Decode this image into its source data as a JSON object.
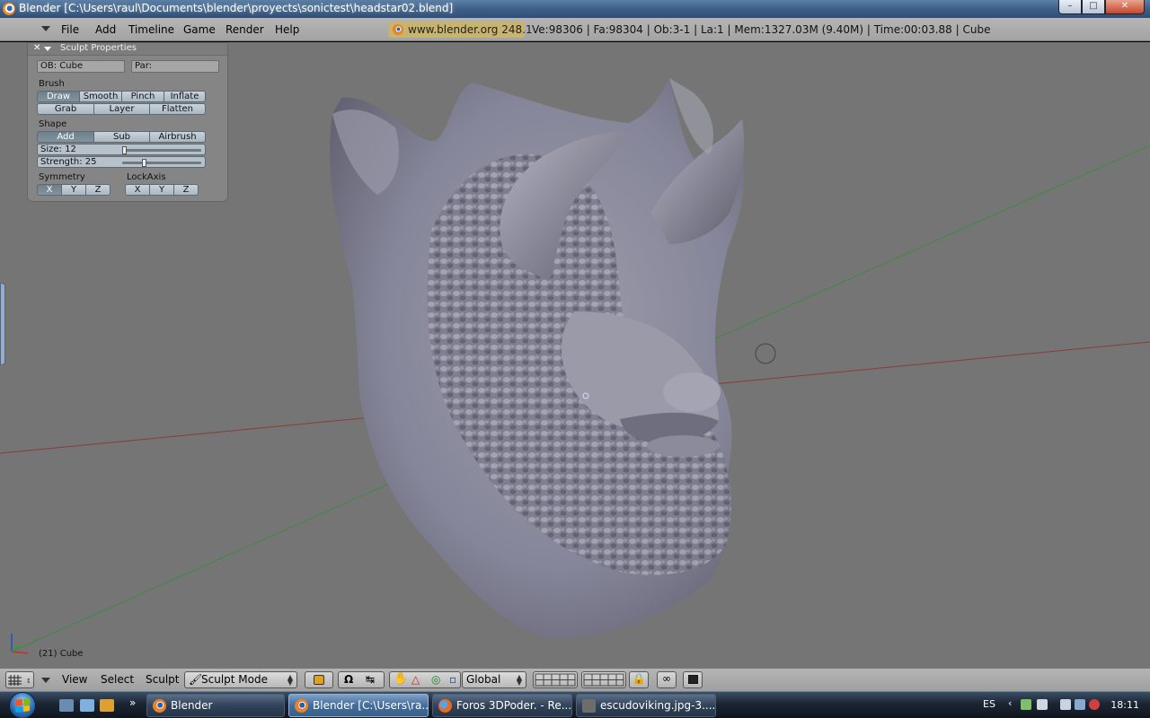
{
  "window": {
    "title": "Blender [C:\\Users\\raul\\Documents\\blender\\proyects\\sonictest\\headstar02.blend]",
    "controls": [
      "minimize",
      "maximize",
      "close"
    ]
  },
  "menubar": {
    "items": [
      "File",
      "Add",
      "Timeline",
      "Game",
      "Render",
      "Help"
    ],
    "version_chip": "www.blender.org 248.1",
    "stats": "Ve:98306 | Fa:98304 | Ob:3-1 | La:1  | Mem:1327.03M (9.40M)  | Time:00:03.88 | Cube"
  },
  "sculpt_panel": {
    "title": "Sculpt Properties",
    "ob_field": "OB: Cube",
    "par_field": "Par:",
    "brush_label": "Brush",
    "brush_row1": [
      "Draw",
      "Smooth",
      "Pinch",
      "Inflate"
    ],
    "brush_row2": [
      "Grab",
      "Layer",
      "Flatten"
    ],
    "active_brush": "Draw",
    "shape_label": "Shape",
    "shape_buttons": [
      "Add",
      "Sub",
      "Airbrush"
    ],
    "active_shape": "Add",
    "size_label": "Size: 12",
    "size_value": 12,
    "strength_label": "Strength: 25",
    "strength_value": 25,
    "symmetry_label": "Symmetry",
    "symmetry_buttons": [
      "X",
      "Y",
      "Z"
    ],
    "lockaxis_label": "LockAxis",
    "lockaxis_buttons": [
      "X",
      "Y",
      "Z"
    ]
  },
  "viewport": {
    "object_label": "(21) Cube",
    "model": "demon head with horns and beard",
    "mesh_color": "#8e8e9e",
    "background_color": "#757575"
  },
  "header3d": {
    "menus": [
      "View",
      "Select",
      "Sculpt"
    ],
    "mode": "Sculpt Mode",
    "orientation": "Global"
  },
  "taskbar": {
    "tasks": [
      {
        "label": "Blender",
        "icon": "blender-icon"
      },
      {
        "label": "Blender [C:\\Users\\ra...",
        "icon": "blender-icon",
        "active": true
      },
      {
        "label": "Foros 3DPoder. - Re...",
        "icon": "firefox-icon"
      },
      {
        "label": "escudoviking.jpg-3....",
        "icon": "image-icon"
      }
    ],
    "language": "ES",
    "clock": "18:11"
  }
}
